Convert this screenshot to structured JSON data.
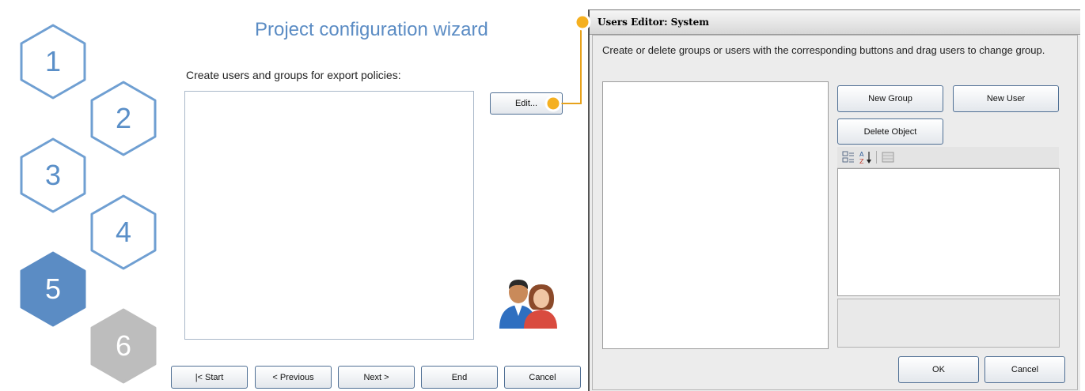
{
  "wizard": {
    "title": "Project configuration wizard",
    "instruction": "Create users and groups for export policies:",
    "edit_button": "Edit...",
    "steps": [
      "1",
      "2",
      "3",
      "4",
      "5",
      "6"
    ],
    "active_step": "5",
    "nav": {
      "start": "|< Start",
      "previous": "< Previous",
      "next": "Next >",
      "end": "End",
      "cancel": "Cancel"
    },
    "icon": "users-icon",
    "colors": {
      "hex_outline": "#6f9fd2",
      "hex_active": "#5b8cc4",
      "hex_disabled": "#bdbdbd",
      "connector": "#e7a21c"
    }
  },
  "dialog": {
    "title": "Users Editor: System",
    "instruction": "Create or delete groups or users with the corresponding buttons and drag users to change group.",
    "new_group": "New Group",
    "new_user": "New User",
    "delete_object": "Delete Object",
    "toolbar_icons": [
      "categorized-icon",
      "sort-alphabetical-icon",
      "property-pages-icon"
    ],
    "ok": "OK",
    "cancel": "Cancel"
  }
}
